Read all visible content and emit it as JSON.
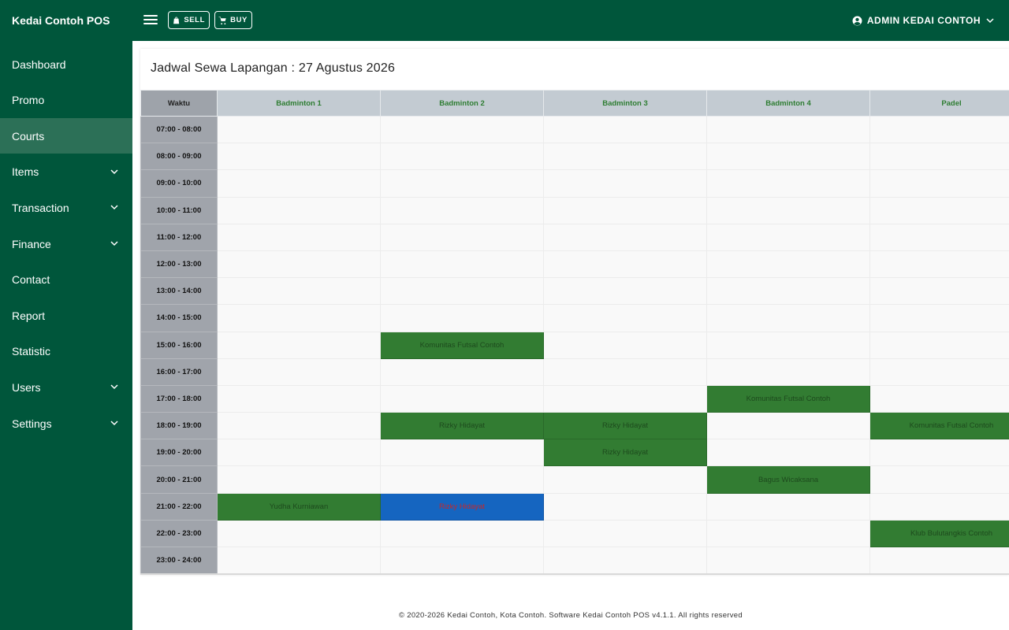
{
  "app": {
    "brand": "Kedai Contoh POS"
  },
  "topbar": {
    "sell_label": "SELL",
    "buy_label": "BUY",
    "user_label": "ADMIN KEDAI CONTOH"
  },
  "sidebar": {
    "items": [
      {
        "label": "Dashboard",
        "has_submenu": false,
        "active": false
      },
      {
        "label": "Promo",
        "has_submenu": false,
        "active": false
      },
      {
        "label": "Courts",
        "has_submenu": false,
        "active": true
      },
      {
        "label": "Items",
        "has_submenu": true,
        "active": false
      },
      {
        "label": "Transaction",
        "has_submenu": true,
        "active": false
      },
      {
        "label": "Finance",
        "has_submenu": true,
        "active": false
      },
      {
        "label": "Contact",
        "has_submenu": false,
        "active": false
      },
      {
        "label": "Report",
        "has_submenu": false,
        "active": false
      },
      {
        "label": "Statistic",
        "has_submenu": false,
        "active": false
      },
      {
        "label": "Users",
        "has_submenu": true,
        "active": false
      },
      {
        "label": "Settings",
        "has_submenu": true,
        "active": false
      }
    ]
  },
  "schedule": {
    "title": "Jadwal Sewa Lapangan : 27 Agustus 2026",
    "time_header": "Waktu",
    "courts": [
      "Badminton 1",
      "Badminton 2",
      "Badminton 3",
      "Badminton 4",
      "Padel"
    ],
    "times": [
      "07:00 - 08:00",
      "08:00 - 09:00",
      "09:00 - 10:00",
      "10:00 - 11:00",
      "11:00 - 12:00",
      "12:00 - 13:00",
      "13:00 - 14:00",
      "14:00 - 15:00",
      "15:00 - 16:00",
      "16:00 - 17:00",
      "17:00 - 18:00",
      "18:00 - 19:00",
      "19:00 - 20:00",
      "20:00 - 21:00",
      "21:00 - 22:00",
      "22:00 - 23:00",
      "23:00 - 24:00"
    ],
    "bookings": [
      {
        "time": "15:00 - 16:00",
        "court": "Badminton 2",
        "name": "Komunitas Futsal Contoh"
      },
      {
        "time": "17:00 - 18:00",
        "court": "Badminton 4",
        "name": "Komunitas Futsal Contoh"
      },
      {
        "time": "18:00 - 19:00",
        "court": "Badminton 2",
        "name": "Rizky Hidayat"
      },
      {
        "time": "18:00 - 19:00",
        "court": "Badminton 3",
        "name": "Rizky Hidayat"
      },
      {
        "time": "18:00 - 19:00",
        "court": "Padel",
        "name": "Komunitas Futsal Contoh"
      },
      {
        "time": "19:00 - 20:00",
        "court": "Badminton 3",
        "name": "Rizky Hidayat"
      },
      {
        "time": "20:00 - 21:00",
        "court": "Badminton 4",
        "name": "Bagus Wicaksana"
      },
      {
        "time": "21:00 - 22:00",
        "court": "Badminton 1",
        "name": "Yudha Kurniawan"
      },
      {
        "time": "21:00 - 22:00",
        "court": "Badminton 2",
        "name": "Rizky Hidayat",
        "selected": true
      },
      {
        "time": "22:00 - 23:00",
        "court": "Padel",
        "name": "Klub Bulutangkis Contoh"
      }
    ]
  },
  "footer": {
    "text": "© 2020-2026 Kedai Contoh, Kota Contoh. Software Kedai Contoh POS v4.1.1. All rights reserved"
  },
  "colors": {
    "primary": "#00563b",
    "sidebar_active": "#2c7057",
    "booked": "#327c32",
    "selected": "#1565c0",
    "court_header_text": "#2e7d32"
  },
  "icons": {
    "menu": "hamburger-icon",
    "sell": "shopping-bag-icon",
    "buy": "cart-icon",
    "user": "user-circle-icon",
    "dropdown": "chevron-down-icon"
  }
}
